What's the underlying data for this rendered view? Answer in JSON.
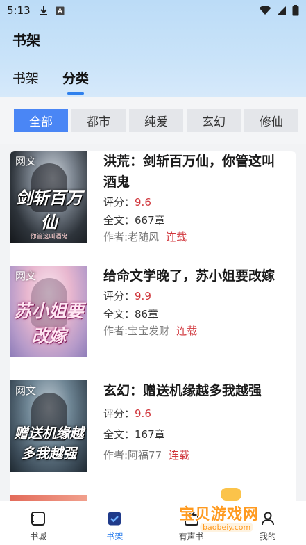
{
  "status_bar": {
    "time": "5:13"
  },
  "header": {
    "title": "书架"
  },
  "tabs": [
    {
      "label": "书架"
    },
    {
      "label": "分类"
    }
  ],
  "filters": [
    {
      "label": "全部"
    },
    {
      "label": "都市"
    },
    {
      "label": "纯爱"
    },
    {
      "label": "玄幻"
    },
    {
      "label": "修仙"
    }
  ],
  "books": [
    {
      "tag": "网文",
      "cover_title": "剑斩百万仙",
      "cover_subtitle": "你管这叫酒鬼",
      "title": "洪荒：剑斩百万仙，你管这叫酒鬼",
      "score_label": "评分：",
      "score": "9.6",
      "chapters_label": "全文：",
      "chapters": "667章",
      "author": "作者:老随风",
      "status": "连载"
    },
    {
      "tag": "网文",
      "cover_title": "苏小姐要改嫁",
      "cover_subtitle": "",
      "title": "给命文学晚了，苏小姐要改嫁",
      "score_label": "评分：",
      "score": "9.9",
      "chapters_label": "全文：",
      "chapters": "86章",
      "author": "作者:宝宝发财",
      "status": "连载"
    },
    {
      "tag": "网文",
      "cover_title": "赠送机缘越多我越强",
      "cover_subtitle": "",
      "title": "玄幻：赠送机缘越多我越强",
      "score_label": "评分：",
      "score": "9.6",
      "chapters_label": "全文：",
      "chapters": "167章",
      "author": "作者:阿福77",
      "status": "连载"
    }
  ],
  "tabbar": [
    {
      "label": "书城",
      "icon": "bookstore-icon"
    },
    {
      "label": "书架",
      "icon": "bookshelf-icon"
    },
    {
      "label": "有声书",
      "icon": "audiobook-icon"
    },
    {
      "label": "我的",
      "icon": "profile-icon"
    }
  ],
  "watermark": {
    "text": "宝贝游戏网",
    "url": "baobeiy.com"
  },
  "colors": {
    "accent": "#2f80ed",
    "chip_active": "#4a86f5",
    "score": "#d0353b"
  }
}
